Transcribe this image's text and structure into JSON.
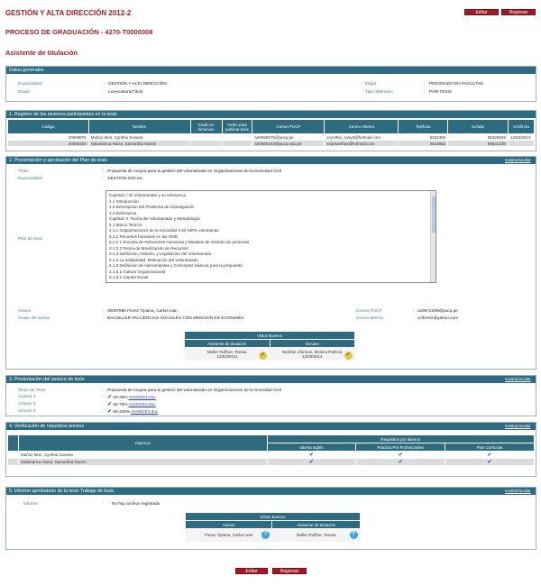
{
  "header": {
    "title": "GESTIÓN Y ALTA DIRECCIÓN 2012-2",
    "process": "PROCESO DE GRADUACIÓN - 4270-T0000008",
    "subtitle": "Asistente de titulación",
    "edit": "Editar",
    "back": "Regresar"
  },
  "general": {
    "title": "Datos generales",
    "esp_label": "Especialidad",
    "esp_value": "GESTIÓN Y ALTA DIRECCIÓN",
    "grado_label": "Grado",
    "grado_value": "Licenciatura/Título",
    "etapa_label": "Etapa",
    "etapa_value": "PREGRADO EN FACULTAD",
    "tipo_label": "Tipo obtención",
    "tipo_value": "POR TESIS"
  },
  "students": {
    "title": "1. Registro de los alumnos participantes en la tesis",
    "headers": [
      "Código",
      "Nombre",
      "Grado en femenino",
      "Vo/Bo para publicar tesis",
      "Correo PUCP",
      "Correo Alterno",
      "Teléfono",
      "Celular",
      "Confirma"
    ],
    "rows": [
      [
        "20068075",
        "Muñoz Mori, Cynthia Susana",
        "",
        "",
        "a20068075@pucp.pe",
        "xcynthia_susy3@hotmail.com",
        "5452369",
        "95326539",
        "12/03/2013"
      ],
      [
        "20068154",
        "Salamanca Huiza, Samantha Noemí",
        "",
        "",
        "a20068154@pucp.edu.pe",
        "xsamanthas@hotmail.com",
        "4523652",
        "98541236",
        ""
      ]
    ]
  },
  "plan": {
    "title": "2. Presentación y aprobación del Plan de tesis",
    "toggle": "mostrar/ocultar",
    "titulo_label": "Título",
    "titulo_value": "Propuesta de mejora para la gestión del voluntariado en Organizaciones de la Sociedad Civil",
    "esp_label": "Especialidad",
    "esp_value": "GESTIÓN SOCIAL",
    "plan_label": "Plan de tesis",
    "plan_lines": [
      "Capítulo I: El Voluntariado y su relevancia",
      "1.1 Introducción",
      "1.2 Descripción del Problema de Investigación",
      "1.3 Relevancia",
      "Capítulo II: Teoría del Voluntariado y Metodología",
      "2.1 Marco Teórico",
      "2.1.1 Organizaciones de la Sociedad Civil 100% voluntarias",
      "2.1.2 Recursos humanos en las ONG",
      "2.1.2.1 Escuela de Relaciones Humanas y Modelos de Gestión de personas",
      "2.1.2.2 Teoría de Movilización de Recursos",
      "2.1.3 Definición, Historia, y Legislación del Voluntariado",
      "2.1.4 La solidaridad: Motivación del Voluntariado",
      "2.1.5 Definición de Herramientas y Conceptos básicos para la propuesta",
      "2.1.5.1 Cultura Organizacional",
      "2.1.5.2 Capital Social"
    ],
    "asesor_label": "Asesor",
    "asesor_value": "00007896 Florez Tipiana, Carlos Ivan",
    "grado_label": "Grado del asesor",
    "grado_value": "BACHILLER EN CIENCIAS SOCIALES CON MENCIÓN EN ECONOMÍA",
    "cpucp_label": "Correo PUCP",
    "cpucp_value": "a19672299@pucp.pe",
    "calt_label": "Correo alterno",
    "calt_value": "xcflorezt@yahoo.com",
    "vb_title": "Vistos Buenos",
    "vb_h1": "Asistente de titulación",
    "vb_h2": "Decano",
    "vb_n1": "Muller Ruffner, Teresa",
    "vb_d1": "12/03/2013",
    "vb_n2": "Bonifaz Chirinos, Monica Patricia",
    "vb_d2": "12/03/2013"
  },
  "avance": {
    "title": "3. Presentación del avance de tesis",
    "toggle": "mostrar/ocultar",
    "titulo_label": "Título de Tesis",
    "titulo_value": "Propuesta de mejora para la gestión del voluntariado en Organizaciones de la Sociedad Civil",
    "items": [
      {
        "label": "Avance 1",
        "range": "20-39%",
        "file": "AVANCE1.doc"
      },
      {
        "label": "Avance 2",
        "range": "60-79%",
        "file": "AVANCE2.doc"
      },
      {
        "label": "Avance 3",
        "range": "80-100%",
        "file": "AVANCE3.doc"
      }
    ]
  },
  "requisitos": {
    "title": "4. Verificación de requisitos previos",
    "toggle": "mostrar/ocultar",
    "h_alumnos": "Alumnos",
    "h_req": "Requisitos por alumno",
    "h_cols": [
      "Idioma Inglés",
      "Práctica Pre Profesionales",
      "Plan Curricular"
    ],
    "rows": [
      "Muñoz Mori, Cynthia Susana",
      "Salamanca Huiza, Samantha Noemí"
    ]
  },
  "informe": {
    "title": "5. Informe aprobatorio de la tesis Trabajo de tesis",
    "toggle": "mostrar/ocultar",
    "label": "Informe",
    "value": "No hay archivo registrado",
    "vb_title": "Vistos Buenos",
    "h1": "Asesor",
    "h2": "Asistente de titulación",
    "n1": "Florez Tipiana, Carlos Ivan",
    "n2": "Muller Ruffner, Teresa"
  },
  "footer": {
    "edit": "Editar",
    "back": "Regresar"
  }
}
